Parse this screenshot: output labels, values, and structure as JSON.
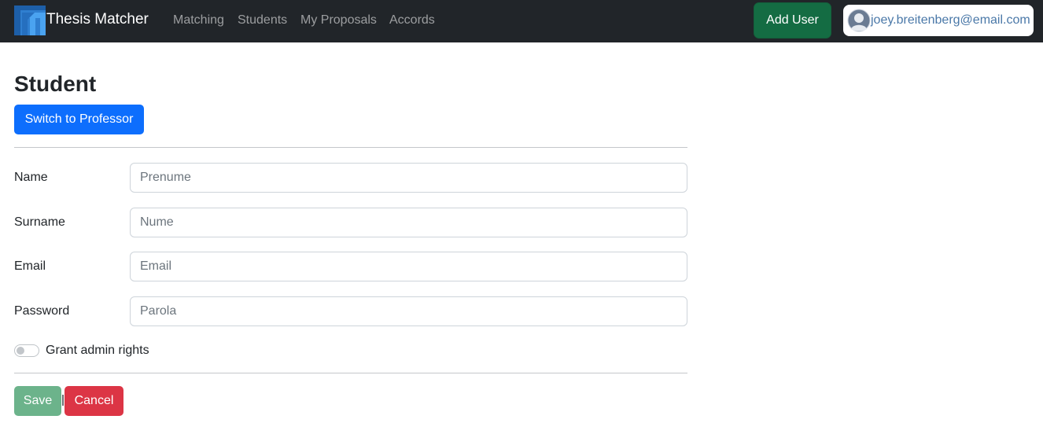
{
  "navbar": {
    "logo_icon": "thesis-matcher-logo",
    "brand_title": "Thesis Matcher",
    "links": [
      {
        "label": "Matching"
      },
      {
        "label": "Students"
      },
      {
        "label": "My Proposals"
      },
      {
        "label": "Accords"
      }
    ],
    "add_user_label": "Add User",
    "user": {
      "avatar_icon": "user-avatar-icon",
      "email": "joey.breitenberg@email.com"
    }
  },
  "form": {
    "title": "Student",
    "switch_label": "Switch to Professor",
    "fields": [
      {
        "label": "Name",
        "value": "",
        "placeholder": "Prenume"
      },
      {
        "label": "Surname",
        "value": "",
        "placeholder": "Nume"
      },
      {
        "label": "Email",
        "value": "",
        "placeholder": "Email"
      },
      {
        "label": "Password",
        "value": "",
        "placeholder": "Parola"
      }
    ],
    "admin_toggle": {
      "label": "Grant admin rights",
      "checked": false
    },
    "save_label": "Save",
    "cancel_label": "Cancel"
  },
  "colors": {
    "navbar_bg": "#212529",
    "add_user_bg": "#146c43",
    "primary": "#0d6efd",
    "save_bg": "#6cb38b",
    "cancel_bg": "#dc3545",
    "email_text": "#4a78a8",
    "logo_blue": "#2f7fd0"
  }
}
